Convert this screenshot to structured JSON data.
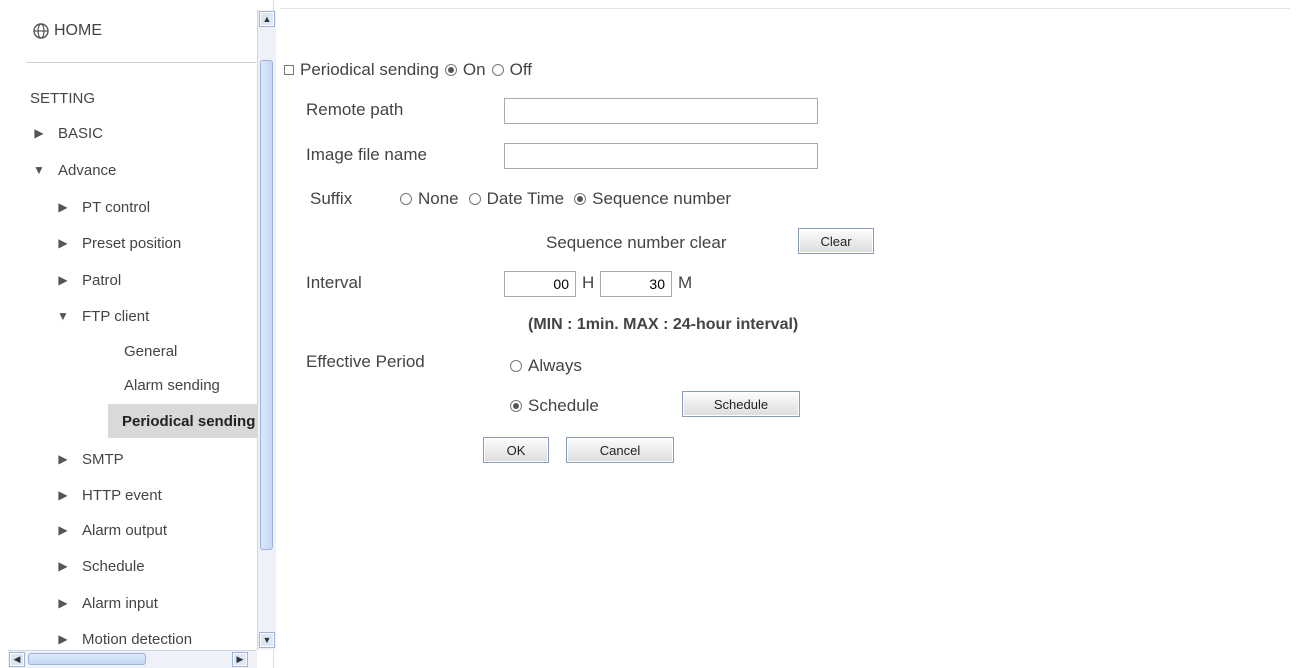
{
  "sidebar": {
    "home": "HOME",
    "setting": "SETTING",
    "items": [
      {
        "label": "BASIC",
        "expanded": false
      },
      {
        "label": "Advance",
        "expanded": true
      },
      {
        "label": "PT control"
      },
      {
        "label": "Preset position"
      },
      {
        "label": "Patrol"
      },
      {
        "label": "FTP client",
        "expanded": true
      },
      {
        "label": "SMTP"
      },
      {
        "label": "HTTP event"
      },
      {
        "label": "Alarm output"
      },
      {
        "label": "Schedule"
      },
      {
        "label": "Alarm input"
      },
      {
        "label": "Motion detection"
      }
    ],
    "ftp_sub": [
      "General",
      "Alarm sending",
      "Periodical sending"
    ]
  },
  "form": {
    "periodical_sending": {
      "label": "Periodical sending",
      "on": "On",
      "off": "Off",
      "selected": "On"
    },
    "remote_path": {
      "label": "Remote path",
      "value": ""
    },
    "image_file_name": {
      "label": "Image file name",
      "value": ""
    },
    "suffix": {
      "label": "Suffix",
      "options": [
        "None",
        "Date Time",
        "Sequence number"
      ],
      "selected": "Sequence number"
    },
    "sequence_clear": {
      "label": "Sequence number clear",
      "button": "Clear"
    },
    "interval": {
      "label": "Interval",
      "hours": "00",
      "hours_unit": "H",
      "minutes": "30",
      "minutes_unit": "M",
      "note": "(MIN : 1min. MAX : 24-hour interval)"
    },
    "effective_period": {
      "label": "Effective Period",
      "always": "Always",
      "schedule": "Schedule",
      "schedule_button": "Schedule",
      "selected": "Schedule"
    },
    "ok": "OK",
    "cancel": "Cancel"
  },
  "colors": {
    "active_item_bg": "#d9d9d9",
    "scrollbar": "#c5d7f4"
  }
}
